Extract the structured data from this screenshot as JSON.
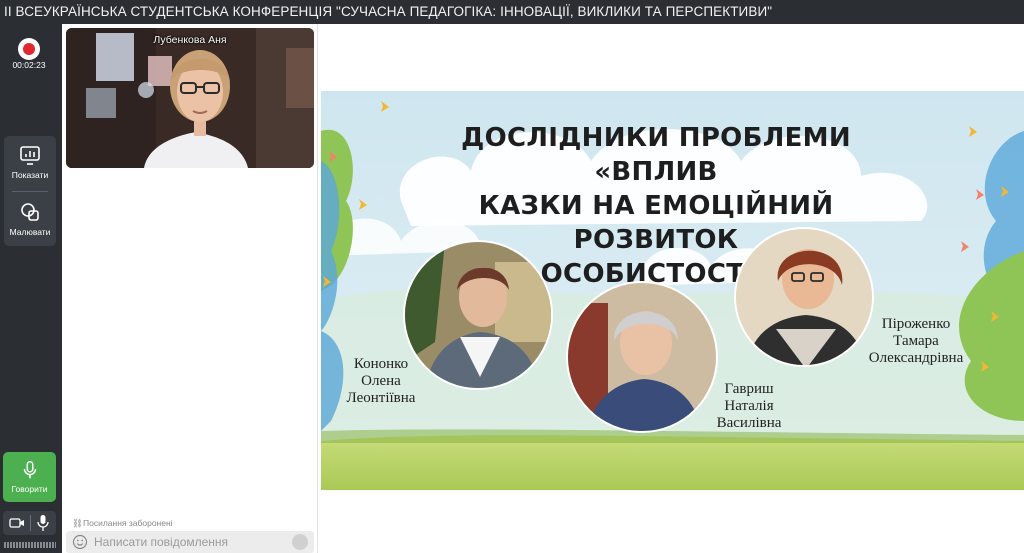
{
  "window": {
    "title": "ІІ ВСЕУКРАЇНСЬКА СТУДЕНТСЬКА КОНФЕРЕНЦІЯ \"СУЧАСНА ПЕДАГОГІКА: ІННОВАЦІЇ, ВИКЛИКИ ТА ПЕРСПЕКТИВИ\""
  },
  "toolbar": {
    "timer": "00:02:23",
    "show_label": "Показати",
    "draw_label": "Малювати",
    "speak_label": "Говорити"
  },
  "video": {
    "participant_name": "Лубенкова Аня"
  },
  "chat": {
    "links_notice": "Посилання заборонені",
    "input_placeholder": "Написати повідомлення"
  },
  "slide": {
    "title_lines": [
      "ДОСЛІДНИКИ ПРОБЛЕМИ «ВПЛИВ",
      "КАЗКИ НА ЕМОЦІЙНИЙ РОЗВИТОК",
      "ОСОБИСТОСТІ»"
    ],
    "researchers": [
      {
        "lines": [
          "Кононко",
          "Олена",
          "Леонтіївна"
        ]
      },
      {
        "lines": [
          "Гавриш",
          "Наталія",
          "Василівна"
        ]
      },
      {
        "lines": [
          "Піроженко",
          "Тамара",
          "Олександрівна"
        ]
      }
    ]
  },
  "colors": {
    "record": "#e0282e",
    "speak": "#4caf50",
    "toolbar_bg": "#2b2f33"
  }
}
